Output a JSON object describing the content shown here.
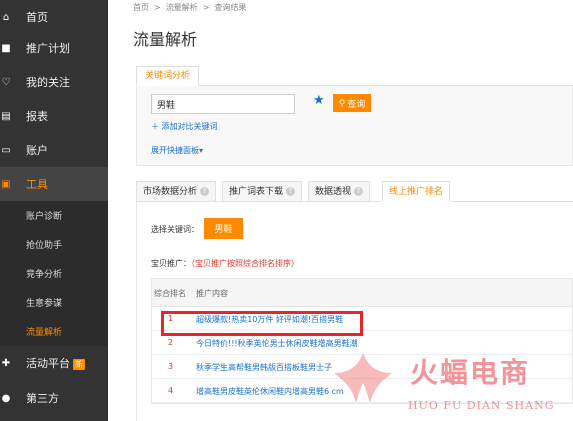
{
  "sidebar": {
    "items": [
      {
        "label": "首页",
        "icon": "home-icon"
      },
      {
        "label": "推广计划",
        "icon": "briefcase-icon"
      },
      {
        "label": "我的关注",
        "icon": "heart-icon"
      },
      {
        "label": "报表",
        "icon": "report-icon"
      },
      {
        "label": "账户",
        "icon": "card-icon"
      },
      {
        "label": "工具",
        "icon": "toolbox-icon"
      }
    ],
    "sub_items": [
      {
        "label": "账户诊断"
      },
      {
        "label": "抢位助手"
      },
      {
        "label": "竞争分析"
      },
      {
        "label": "生意参谋"
      },
      {
        "label": "流量解析"
      }
    ],
    "bottom_items": [
      {
        "label": "活动平台",
        "badge": "新",
        "icon": "gift-icon"
      },
      {
        "label": "第三方",
        "icon": "cube-icon"
      }
    ]
  },
  "breadcrumb": {
    "home": "首页",
    "level2": "流量解析",
    "current": "查询结果",
    "sep": ">"
  },
  "page_title": "流量解析",
  "keyword_tab": {
    "label": "关键词分析"
  },
  "search": {
    "value": "男鞋",
    "query_label": "查询",
    "add_compare_label": "添加对比关键词",
    "expand_label": "展开快捷面板"
  },
  "data_tabs": [
    {
      "label": "市场数据分析",
      "help": "?"
    },
    {
      "label": "推广词表下载",
      "help": "?"
    },
    {
      "label": "数据透视",
      "help": "?"
    },
    {
      "label": "线上推广排名",
      "help": ""
    }
  ],
  "content": {
    "select_label": "选择关键词：",
    "keyword": "男鞋",
    "promo_label": "宝贝推广：",
    "promo_note": "（宝贝推广按照综合排名排序）",
    "table": {
      "headers": {
        "rank": "综合排名",
        "content": "推广内容"
      },
      "rows": [
        {
          "rank": "1",
          "text": "超级爆款!热卖10万件 好评如潮!百搭男鞋"
        },
        {
          "rank": "2",
          "text": "今日特价!!!秋季英伦男士休闲皮鞋增高男鞋潮"
        },
        {
          "rank": "3",
          "text": "秋季学生高帮鞋男韩版百搭板鞋男士子"
        },
        {
          "rank": "4",
          "text": "增高鞋男皮鞋英伦休闲鞋内增高男鞋6 cm"
        }
      ]
    }
  },
  "watermark": {
    "title": "火蝠电商",
    "subtitle": "HUO FU DIAN SHANG"
  },
  "colors": {
    "accent": "#ff8a00",
    "link": "#1a6fd6",
    "highlight": "#e8242a",
    "sidebar": "#333333"
  }
}
